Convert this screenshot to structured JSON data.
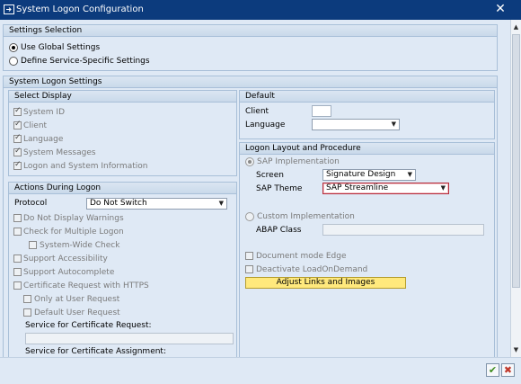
{
  "window": {
    "title": "System Logon Configuration",
    "close_glyph": "✕"
  },
  "settings_selection": {
    "header": "Settings Selection",
    "use_global": "Use Global Settings",
    "define_specific": "Define Service-Specific Settings"
  },
  "system_logon": {
    "header": "System Logon Settings",
    "select_display": {
      "header": "Select Display",
      "items": [
        "System ID",
        "Client",
        "Language",
        "System Messages",
        "Logon and System Information"
      ]
    },
    "actions": {
      "header": "Actions During Logon",
      "protocol_label": "Protocol",
      "protocol_value": "Do Not Switch",
      "dont_display_warnings": "Do Not Display Warnings",
      "check_multiple_logon": "Check for Multiple Logon",
      "system_wide_check": "System-Wide Check",
      "support_accessibility": "Support Accessibility",
      "support_autocomplete": "Support Autocomplete",
      "cert_request_https": "Certificate Request with HTTPS",
      "only_at_user_request": "Only at User Request",
      "default_user_request": "Default User Request",
      "service_cert_request": "Service for Certificate Request:",
      "service_cert_assignment": "Service for Certificate Assignment:"
    },
    "default": {
      "header": "Default",
      "client_label": "Client",
      "client_value": "",
      "language_label": "Language",
      "language_value": ""
    },
    "layout": {
      "header": "Logon Layout and Procedure",
      "sap_implementation": "SAP Implementation",
      "screen_label": "Screen",
      "screen_value": "Signature Design",
      "theme_label": "SAP Theme",
      "theme_value": "SAP Streamline",
      "custom_implementation": "Custom Implementation",
      "abap_class_label": "ABAP Class",
      "abap_class_value": "",
      "document_mode_edge": "Document mode Edge",
      "deactivate_load": "Deactivate LoadOnDemand",
      "adjust_button": "Adjust Links and Images"
    }
  },
  "footer": {
    "ok_glyph": "✔",
    "cancel_glyph": "✖"
  },
  "colors": {
    "titlebar": "#0c3b7d",
    "background": "#dfe9f5",
    "button_yellow": "#ffe97d",
    "required_border": "#b42b3a"
  }
}
